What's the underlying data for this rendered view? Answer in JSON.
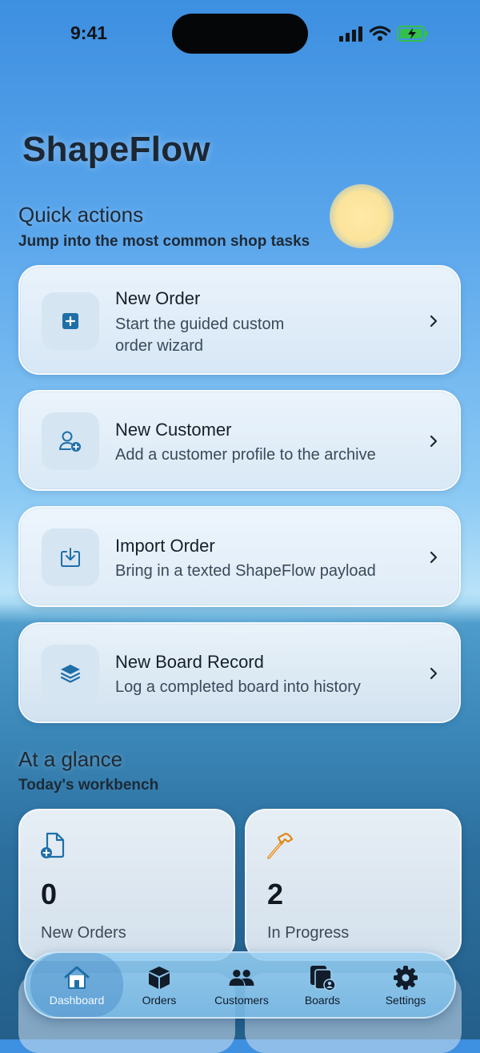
{
  "status_bar": {
    "time": "9:41"
  },
  "app": {
    "title": "ShapeFlow"
  },
  "quick_actions": {
    "title": "Quick actions",
    "subtitle": "Jump into the most common shop tasks",
    "items": [
      {
        "title": "New Order",
        "subtitle": "Start the guided custom order wizard",
        "icon": "plus-square-icon"
      },
      {
        "title": "New Customer",
        "subtitle": "Add a customer profile to the archive",
        "icon": "person-add-icon"
      },
      {
        "title": "Import Order",
        "subtitle": "Bring in a texted ShapeFlow payload",
        "icon": "import-tray-icon"
      },
      {
        "title": "New Board Record",
        "subtitle": "Log a completed board into history",
        "icon": "layers-icon"
      }
    ]
  },
  "glance": {
    "title": "At a glance",
    "subtitle": "Today's workbench",
    "cards": [
      {
        "value": "0",
        "label": "New Orders",
        "icon": "document-add-icon"
      },
      {
        "value": "2",
        "label": "In Progress",
        "icon": "hammer-icon"
      }
    ]
  },
  "tab_bar": {
    "items": [
      {
        "label": "Dashboard",
        "icon": "house-icon",
        "active": true
      },
      {
        "label": "Orders",
        "icon": "box-icon"
      },
      {
        "label": "Customers",
        "icon": "people-icon"
      },
      {
        "label": "Boards",
        "icon": "boards-icon"
      },
      {
        "label": "Settings",
        "icon": "gear-icon"
      }
    ]
  },
  "colors": {
    "accent": "#1f6fa8",
    "hammer": "#e08a1e",
    "active_tab": "#4a8cc8"
  }
}
